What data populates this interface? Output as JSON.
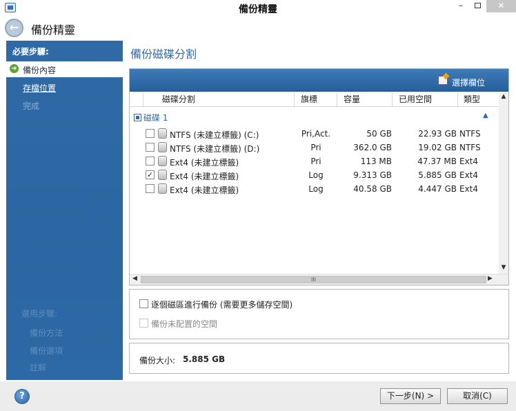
{
  "window": {
    "title": "備份精靈",
    "minimize": "–",
    "close": "✕"
  },
  "header": {
    "title": "備份精靈"
  },
  "sidebar": {
    "heading": "必要步驟:",
    "steps": [
      {
        "label": "備份內容",
        "state": "active"
      },
      {
        "label": "存檔位置",
        "state": "link"
      },
      {
        "label": "完成",
        "state": "disabled"
      }
    ],
    "optional_heading": "選用步驟:",
    "optional_steps": [
      "備份方法",
      "備份選項",
      "註解"
    ]
  },
  "main": {
    "title": "備份磁碟分割",
    "toolbar": {
      "select_columns": "選擇欄位"
    },
    "columns": [
      "磁碟分割",
      "旗標",
      "容量",
      "已用空間",
      "類型"
    ],
    "disk_group": "磁碟 1",
    "rows": [
      {
        "checked": false,
        "name": "NTFS (未建立標籤) (C:)",
        "flags": "Pri,Act.",
        "capacity": "50 GB",
        "used": "22.93 GB",
        "type": "NTFS"
      },
      {
        "checked": false,
        "name": "NTFS (未建立標籤) (D:)",
        "flags": "Pri",
        "capacity": "362.0 GB",
        "used": "19.02 GB",
        "type": "NTFS"
      },
      {
        "checked": false,
        "name": "Ext4 (未建立標籤)",
        "flags": "Pri",
        "capacity": "113 MB",
        "used": "47.37 MB",
        "type": "Ext4"
      },
      {
        "checked": true,
        "name": "Ext4 (未建立標籤)",
        "flags": "Log",
        "capacity": "9.313 GB",
        "used": "5.885 GB",
        "type": "Ext4"
      },
      {
        "checked": false,
        "name": "Ext4 (未建立標籤)",
        "flags": "Log",
        "capacity": "40.58 GB",
        "used": "4.447 GB",
        "type": "Ext4"
      }
    ],
    "hscroll_thumb": "III",
    "options": {
      "sector_by_sector": "逐個磁區進行備份 (需要更多儲存空間)",
      "unallocated": "備份未配置的空間"
    },
    "backup_size_label": "備份大小:",
    "backup_size_value": "5.885 GB"
  },
  "footer": {
    "help": "?",
    "next": "下一步(N) >",
    "cancel": "取消(C)"
  },
  "colors": {
    "accent": "#2f6aa7",
    "check_green": "#5aa636",
    "close_bg": "#c7c7c7"
  }
}
